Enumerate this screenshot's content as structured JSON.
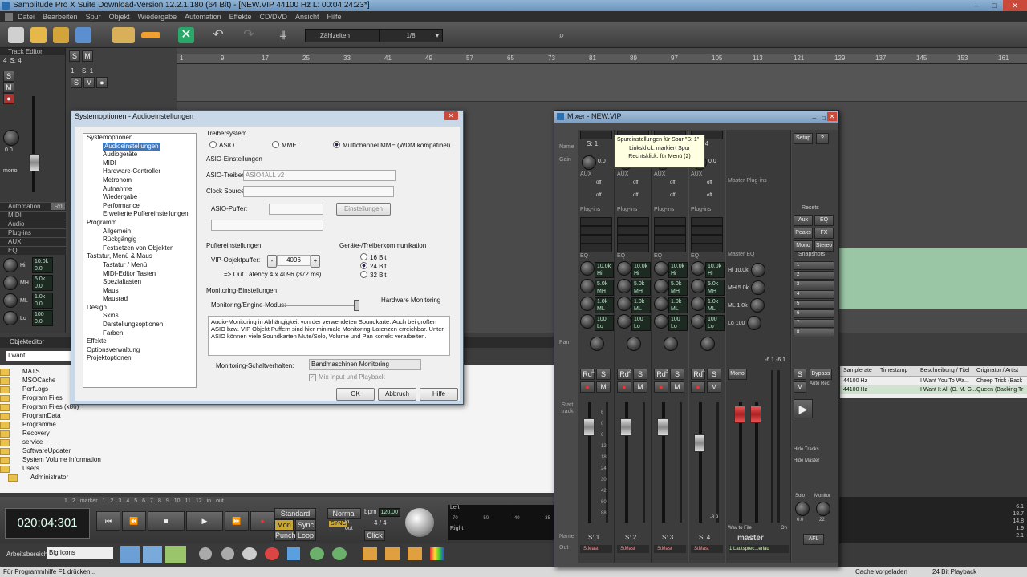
{
  "window": {
    "title": "Samplitude Pro X Suite Download-Version 12.2.1.180 (64 Bit) - [NEW.VIP   44100 Hz L: 00:04:24:23*]",
    "min": "–",
    "max": "□",
    "close": "✕"
  },
  "menu": [
    "Datei",
    "Bearbeiten",
    "Spur",
    "Objekt",
    "Wiedergabe",
    "Automation",
    "Effekte",
    "CD/DVD",
    "Ansicht",
    "Hilfe"
  ],
  "toolbar": {
    "zoom_mode": "Zählzeiten",
    "snap": "1/8",
    "search_placeholder": "Suche"
  },
  "left_panel": {
    "header": "Track Editor",
    "track_num": "4",
    "track_name": "S: 4",
    "gain_value": "0.0",
    "mono_label": "mono",
    "sections": [
      "Automation",
      "MIDI",
      "Audio",
      "Plug-ins",
      "AUX",
      "EQ"
    ],
    "rd": "Rd",
    "eq": [
      {
        "band": "Hi",
        "freq": "10.0k",
        "gain": "0.0"
      },
      {
        "band": "MH",
        "freq": "5.0k",
        "gain": "0.0"
      },
      {
        "band": "ML",
        "freq": "1.0k",
        "gain": "0.0"
      },
      {
        "band": "Lo",
        "freq": "100",
        "gain": "0.0"
      }
    ]
  },
  "track_header": {
    "track": "S: 1",
    "num": "1"
  },
  "ruler": [
    "1",
    "9",
    "17",
    "25",
    "33",
    "41",
    "49",
    "57",
    "65",
    "73",
    "81",
    "89",
    "97",
    "105",
    "113",
    "121",
    "129",
    "137",
    "145",
    "153",
    "161"
  ],
  "lower_tabs": {
    "objekteditor": "Objekteditor",
    "filter": "I want"
  },
  "file_browser": [
    "MATS",
    "MSOCache",
    "PerfLogs",
    "Program Files",
    "Program Files (x86)",
    "ProgramData",
    "Programme",
    "Recovery",
    "service",
    "SoftwareUpdater",
    "System Volume Information",
    "Users",
    "Administrator"
  ],
  "transport": {
    "time": "020:04:301",
    "marker_row": [
      "1",
      "2",
      "marker",
      "1",
      "2",
      "3",
      "4",
      "5",
      "6",
      "7",
      "8",
      "9",
      "10",
      "11",
      "12",
      "in",
      "out"
    ],
    "mode": "Standard",
    "mon": "Mon",
    "sync": "Sync",
    "punch": "Punch",
    "loop": "Loop",
    "normal": "Normal",
    "bpm_label": "bpm",
    "bpm": "120.00",
    "sig": "4 / 4",
    "click": "Click",
    "midi_in": "in",
    "midi_out": "out",
    "level_left": "Left",
    "level_right": "Right",
    "level_scale": [
      "-70",
      "-50",
      "-40",
      "-35"
    ]
  },
  "bottom_bar": {
    "workspace_label": "Arbeitsbereich:",
    "workspace": "Big Icons"
  },
  "status": {
    "left": "Für Programmhilfe F1 drücken...",
    "cache": "Cache vorgeladen",
    "playback": "24 Bit Playback"
  },
  "dialog": {
    "title": "Systemoptionen - Audioeinstellungen",
    "tree": [
      {
        "label": "Systemoptionen",
        "level": 0
      },
      {
        "label": "Audioeinstellungen",
        "level": 1,
        "selected": true
      },
      {
        "label": "Audiogeräte",
        "level": 1
      },
      {
        "label": "MIDI",
        "level": 1
      },
      {
        "label": "Hardware-Controller",
        "level": 1
      },
      {
        "label": "Metronom",
        "level": 1
      },
      {
        "label": "Aufnahme",
        "level": 1
      },
      {
        "label": "Wiedergabe",
        "level": 1
      },
      {
        "label": "Performance",
        "level": 1
      },
      {
        "label": "Erweiterte Puffereinstellungen",
        "level": 1
      },
      {
        "label": "Programm",
        "level": 0
      },
      {
        "label": "Allgemein",
        "level": 1
      },
      {
        "label": "Rückgängig",
        "level": 1
      },
      {
        "label": "Festsetzen von Objekten",
        "level": 1
      },
      {
        "label": "Tastatur, Menü & Maus",
        "level": 0
      },
      {
        "label": "Tastatur / Menü",
        "level": 1
      },
      {
        "label": "MIDI-Editor Tasten",
        "level": 1
      },
      {
        "label": "Spezialtasten",
        "level": 1
      },
      {
        "label": "Maus",
        "level": 1
      },
      {
        "label": "Mausrad",
        "level": 1
      },
      {
        "label": "Design",
        "level": 0
      },
      {
        "label": "Skins",
        "level": 1
      },
      {
        "label": "Darstellungsoptionen",
        "level": 1
      },
      {
        "label": "Farben",
        "level": 1
      },
      {
        "label": "Effekte",
        "level": 0
      },
      {
        "label": "Optionsverwaltung",
        "level": 0
      },
      {
        "label": "Projektoptionen",
        "level": 0
      }
    ],
    "treiber_label": "Treibersystem",
    "treiber_options": [
      "ASIO",
      "MME",
      "Multichannel MME (WDM kompatibel)"
    ],
    "asio_group": "ASIO-Einstellungen",
    "asio_treiber_label": "ASIO-Treiber:",
    "asio_treiber_value": "ASIO4ALL v2",
    "clock_label": "Clock Source:",
    "puffer_label": "ASIO-Puffer:",
    "einstellungen": "Einstellungen",
    "puffer_group": "Puffereinstellungen",
    "vip_label": "VIP-Objektpuffer:",
    "vip_value": "4096",
    "latency": "=> Out Latency 4 x 4096 (372 ms)",
    "geraete_group": "Geräte-/Treiberkommunikation",
    "bits": [
      "16 Bit",
      "24 Bit",
      "32 Bit"
    ],
    "monitoring_group": "Monitoring-Einstellungen",
    "monitoring_mode_label": "Monitoring/Engine-Modus:",
    "hardware_monitoring": "Hardware Monitoring",
    "description": "Audio-Monitoring in Abhängigkeit von der verwendeten Soundkarte. Auch bei großen ASIO bzw. VIP Objekt Puffern sind hier minimale Monitoring-Latenzen erreichbar. Unter ASIO können viele Soundkarten Mute/Solo,  Volume und Pan korrekt verarbeiten.",
    "schalt_label": "Monitoring-Schaltverhalten:",
    "schalt_value": "Bandmaschinen Monitoring",
    "mix_checkbox": "Mix Input und Playback",
    "ok": "OK",
    "cancel": "Abbruch",
    "help": "Hilfe"
  },
  "tooltip": {
    "line1": "Spureinstellungen für Spur \"S: 1\"",
    "line2": "Linksklick: markiert Spur",
    "line3": "Rechtsklick: für Menü (2)"
  },
  "mixer": {
    "title": "Mixer - NEW.VIP",
    "strips": [
      {
        "name": "S: 1",
        "num": "1",
        "out": "StMast"
      },
      {
        "name": "S: 2",
        "num": "2",
        "out": "StMast"
      },
      {
        "name": "S: 3",
        "num": "3",
        "out": "StMast"
      },
      {
        "name": "S: 4",
        "num": "4",
        "out": "StMast"
      }
    ],
    "row_labels": [
      "Name",
      "Gain",
      "AUX",
      "Plug-ins",
      "EQ",
      "Pan",
      "Start track",
      "Name",
      "Out"
    ],
    "master": {
      "name": "master",
      "label": "Master Plug-ins",
      "eq": "Master EQ",
      "out": "1 Lautsprec...erlau",
      "mono": "Mono",
      "wav": "Wav to File",
      "on": "On"
    },
    "setup": "Setup",
    "help": "?",
    "resets": "Resets",
    "aux": "Aux",
    "eq": "EQ",
    "peaks": "Peaks",
    "fx": "FX",
    "mono": "Mono",
    "stereo": "Stereo",
    "snapshots_label": "Snapshots",
    "snapshots": [
      "1",
      "2",
      "3",
      "4",
      "5",
      "6",
      "7",
      "8"
    ],
    "eq_values": [
      {
        "freq": "10.0k",
        "band": "Hi"
      },
      {
        "freq": "5.0k",
        "band": "MH"
      },
      {
        "freq": "1.0k",
        "band": "ML"
      },
      {
        "freq": "100",
        "band": "Lo"
      }
    ],
    "master_eq": [
      "Hi 10.0k",
      "MH 5.0k",
      "ML 1.0k",
      "Lo 100"
    ],
    "off": "off",
    "bypass": "Bypass",
    "auto_rec": "Auto Rec",
    "hide_tracks": "Hide Tracks",
    "hide_master": "Hide Master",
    "solo": "Solo",
    "monitor": "Monitor",
    "afl": "AFL",
    "fader_scale": [
      "6",
      "0",
      "6",
      "12",
      "18",
      "24",
      "30",
      "42",
      "60",
      "88"
    ],
    "gain_values": [
      "0.0",
      "0.0",
      "0.0",
      "0.0"
    ],
    "level": "-8.9",
    "master_level": [
      "-6.1",
      "-6.1"
    ],
    "solo_value": "0.0",
    "monitor_value": "22"
  },
  "right_panel": {
    "columns": [
      "Samplerate",
      "Timestamp",
      "Beschreibung / Titel",
      "Originator / Artist"
    ],
    "rows": [
      [
        "44100 Hz",
        "",
        "I Want You To Wa...",
        "Cheep Trick (Back"
      ],
      [
        "44100 Hz",
        "",
        "I Want It All (O. M. G...",
        "Queen (Backing Tr"
      ]
    ],
    "level_scale": [
      "6.1",
      "18.7",
      "14.8",
      "1.9",
      "2.1"
    ]
  },
  "colors": {
    "accent": "#3a78c4",
    "toolbar_green": "#2aa86a",
    "record_red": "#d43a3a",
    "mixer_bg": "#4a4a4a"
  }
}
